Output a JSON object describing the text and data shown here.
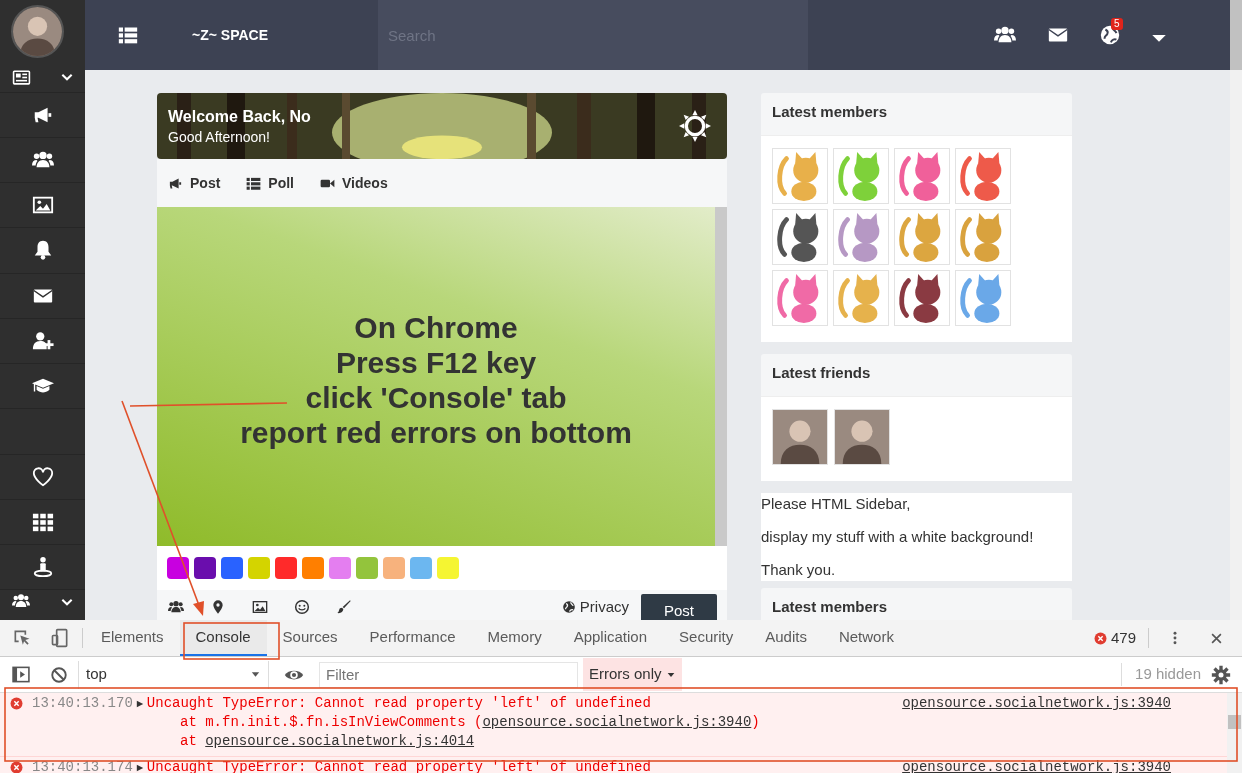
{
  "topbar": {
    "brand": "~Z~ SPACE",
    "search": {
      "placeholder": "Search"
    },
    "notification_badge": "5"
  },
  "welcome": {
    "title": "Welcome Back, No",
    "subtitle": "Good Afternoon!"
  },
  "composer": {
    "tabs": [
      {
        "kind": "post",
        "label": "Post"
      },
      {
        "kind": "poll",
        "label": "Poll"
      },
      {
        "kind": "videos",
        "label": "Videos"
      }
    ],
    "text_lines": [
      "On Chrome",
      "Press F12 key",
      "click 'Console' tab",
      "report red errors on bottom"
    ],
    "swatches": [
      {
        "color": "#c800e0"
      },
      {
        "color": "#6a0dad"
      },
      {
        "color": "#2962ff"
      },
      {
        "color": "#d4d400"
      },
      {
        "color": "#ff2a2a"
      },
      {
        "color": "#ff7f00"
      },
      {
        "color": "#e47ef0"
      },
      {
        "color": "#93c43c"
      },
      {
        "color": "#f7b27d"
      },
      {
        "color": "#6cb7f0"
      },
      {
        "color": "#f5f532"
      }
    ],
    "privacy": "Privacy",
    "post_button": "Post"
  },
  "widgets": [
    {
      "kind": "members",
      "title": "Latest members",
      "members": [
        {
          "color": "#e8b04a"
        },
        {
          "color": "#7ed13a"
        },
        {
          "color": "#f0609a"
        },
        {
          "color": "#ee5a4a"
        },
        {
          "color": "#555555"
        },
        {
          "color": "#b698c4"
        },
        {
          "color": "#dca640"
        },
        {
          "color": "#d9a23e"
        },
        {
          "color": "#f06aa6"
        },
        {
          "color": "#e6b24c"
        },
        {
          "color": "#8a3a42"
        },
        {
          "color": "#6aa8e8"
        }
      ]
    },
    {
      "kind": "friends",
      "title": "Latest friends"
    },
    {
      "kind": "text",
      "lines": [
        "Please HTML Sidebar,",
        "display my stuff with a white background!",
        "Thank you."
      ]
    },
    {
      "kind": "members",
      "title": "Latest members"
    }
  ],
  "devtools": {
    "tabs": [
      {
        "label": "Elements",
        "selected": false
      },
      {
        "label": "Console",
        "selected": true
      },
      {
        "label": "Sources",
        "selected": false
      },
      {
        "label": "Performance",
        "selected": false
      },
      {
        "label": "Memory",
        "selected": false
      },
      {
        "label": "Application",
        "selected": false
      },
      {
        "label": "Security",
        "selected": false
      },
      {
        "label": "Audits",
        "selected": false
      },
      {
        "label": "Network",
        "selected": false
      }
    ],
    "error_count": "479",
    "context": "top",
    "filter": {
      "placeholder": "Filter"
    },
    "level": "Errors only",
    "hidden": "19 hidden",
    "messages": [
      {
        "time": "13:40:13.170",
        "text": "Uncaught TypeError: Cannot read property 'left' of undefined",
        "source": "opensource.socialnetwork.js:3940",
        "stack": [
          {
            "prefix": "at m.fn.init.$.fn.isInViewComments (",
            "link": "opensource.socialnetwork.js:3940",
            "suffix": ")"
          },
          {
            "prefix": "at ",
            "link": "opensource.socialnetwork.js:4014"
          }
        ]
      },
      {
        "time": "13:40:13.174",
        "text": "Uncaught TypeError: Cannot read property 'left' of undefined",
        "source": "opensource.socialnetwork.js:3940"
      }
    ]
  }
}
